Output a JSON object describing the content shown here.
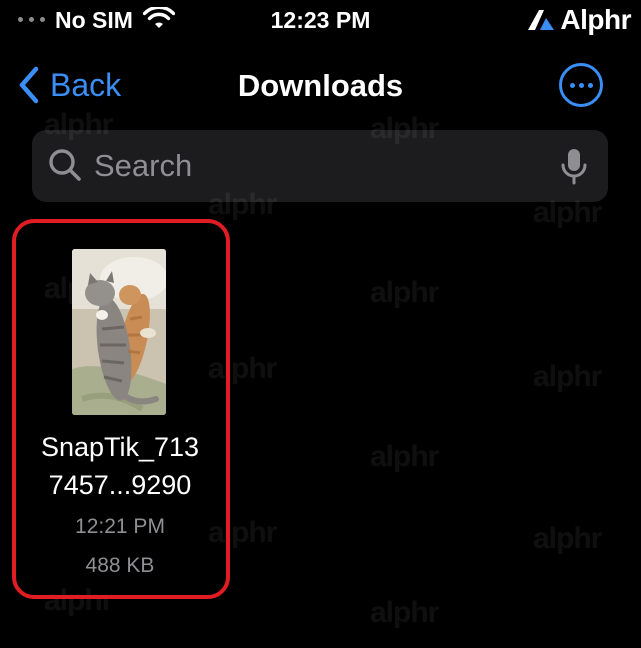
{
  "status_bar": {
    "carrier": "No SIM",
    "time": "12:23 PM",
    "brand": "Alphr"
  },
  "nav": {
    "back_label": "Back",
    "title": "Downloads"
  },
  "search": {
    "placeholder": "Search",
    "value": ""
  },
  "files": [
    {
      "name_line1": "SnapTik_713",
      "name_line2": "7457...9290",
      "time": "12:21 PM",
      "size": "488 KB",
      "thumbnail": "two-kittens-sleeping-photo"
    }
  ],
  "watermark": "alphr",
  "colors": {
    "accent": "#3a8ef6",
    "highlight": "#e11d24",
    "background": "#000000",
    "search_field": "#1c1c1e",
    "secondary_text": "#8e8e93"
  },
  "icons": {
    "signal": "signal-dots-icon",
    "wifi": "wifi-icon",
    "back": "chevron-left-icon",
    "more": "ellipsis-circle-icon",
    "search": "search-icon",
    "mic": "microphone-icon",
    "brand": "alphr-logo-icon"
  }
}
